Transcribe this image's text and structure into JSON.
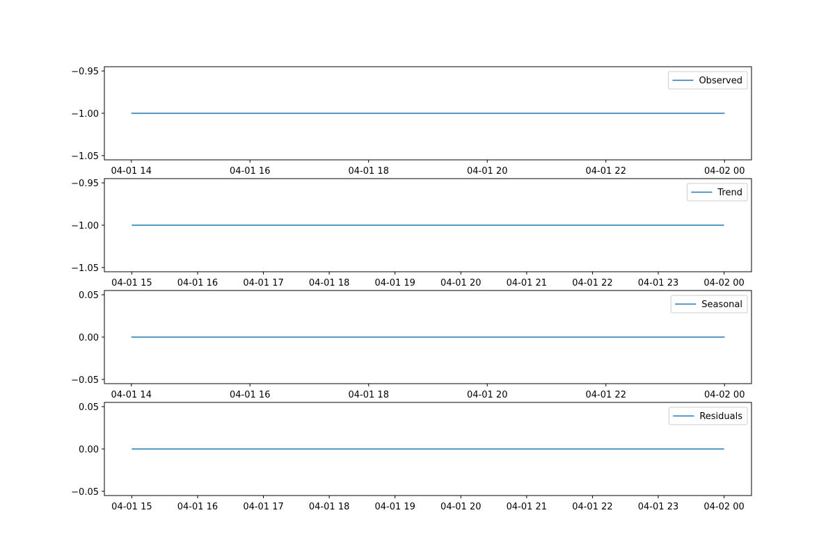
{
  "colors": {
    "series": "#1f77b4"
  },
  "chart_data": [
    {
      "type": "line",
      "legend_position": "upper right",
      "grid": false,
      "x_unit": "datetime",
      "x": [
        "2024-04-01T14:00",
        "2024-04-02T01:00"
      ],
      "x_range": [
        "2024-04-01T13:30",
        "2024-04-02T01:30"
      ],
      "xticks": [
        "04-01 14",
        "04-01 16",
        "04-01 18",
        "04-01 20",
        "04-01 22",
        "04-02 00"
      ],
      "yticks": [
        "−0.95",
        "−1.00",
        "−1.05"
      ],
      "ylim": [
        -1.055,
        -0.945
      ],
      "series": [
        {
          "name": "Observed",
          "values": [
            -1.0,
            -1.0
          ]
        }
      ]
    },
    {
      "type": "line",
      "legend_position": "upper right",
      "grid": false,
      "x_unit": "datetime",
      "x": [
        "2024-04-01T15:00",
        "2024-04-02T00:00"
      ],
      "x_range": [
        "2024-04-01T14:35",
        "2024-04-02T00:25"
      ],
      "xticks": [
        "04-01 15",
        "04-01 16",
        "04-01 17",
        "04-01 18",
        "04-01 19",
        "04-01 20",
        "04-01 21",
        "04-01 22",
        "04-01 23",
        "04-02 00"
      ],
      "yticks": [
        "−0.95",
        "−1.00",
        "−1.05"
      ],
      "ylim": [
        -1.055,
        -0.945
      ],
      "series": [
        {
          "name": "Trend",
          "values": [
            -1.0,
            -1.0
          ]
        }
      ]
    },
    {
      "type": "line",
      "legend_position": "upper right",
      "grid": false,
      "x_unit": "datetime",
      "x": [
        "2024-04-01T14:00",
        "2024-04-02T01:00"
      ],
      "x_range": [
        "2024-04-01T13:30",
        "2024-04-02T01:30"
      ],
      "xticks": [
        "04-01 14",
        "04-01 16",
        "04-01 18",
        "04-01 20",
        "04-01 22",
        "04-02 00"
      ],
      "yticks": [
        "0.05",
        "0.00",
        "−0.05"
      ],
      "ylim": [
        -0.055,
        0.055
      ],
      "series": [
        {
          "name": "Seasonal",
          "values": [
            0.0,
            0.0
          ]
        }
      ]
    },
    {
      "type": "line",
      "legend_position": "upper right",
      "grid": false,
      "x_unit": "datetime",
      "x": [
        "2024-04-01T15:00",
        "2024-04-02T00:00"
      ],
      "x_range": [
        "2024-04-01T14:35",
        "2024-04-02T00:25"
      ],
      "xticks": [
        "04-01 15",
        "04-01 16",
        "04-01 17",
        "04-01 18",
        "04-01 19",
        "04-01 20",
        "04-01 21",
        "04-01 22",
        "04-01 23",
        "04-02 00"
      ],
      "yticks": [
        "0.05",
        "0.00",
        "−0.05"
      ],
      "ylim": [
        -0.055,
        0.055
      ],
      "series": [
        {
          "name": "Residuals",
          "values": [
            0.0,
            0.0
          ]
        }
      ]
    }
  ]
}
